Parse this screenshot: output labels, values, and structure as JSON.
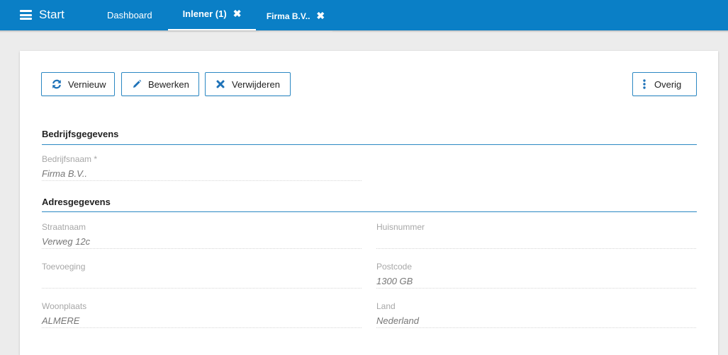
{
  "topbar": {
    "menu_label": "Start",
    "tabs": [
      {
        "label": "Dashboard"
      },
      {
        "label": "Inlener (1)",
        "close": "✖"
      },
      {
        "label": "Firma B.V..",
        "close": "✖"
      }
    ],
    "bar_color": "#0a7fc6"
  },
  "toolbar": {
    "refresh_label": "Vernieuw",
    "edit_label": "Bewerken",
    "delete_label": "Verwijderen",
    "more_label": "Overig",
    "accent": "#2b88c3"
  },
  "sections": {
    "company": {
      "title": "Bedrijfsgegevens",
      "fields": {
        "name": {
          "label": "Bedrijfsnaam *",
          "value": "Firma B.V.."
        }
      }
    },
    "address": {
      "title": "Adresgegevens",
      "fields": {
        "street": {
          "label": "Straatnaam",
          "value": "Verweg 12c"
        },
        "number": {
          "label": "Huisnummer",
          "value": ""
        },
        "addition": {
          "label": "Toevoeging",
          "value": ""
        },
        "postcode": {
          "label": "Postcode",
          "value": "1300 GB"
        },
        "city": {
          "label": "Woonplaats",
          "value": "ALMERE"
        },
        "country": {
          "label": "Land",
          "value": "Nederland"
        }
      }
    }
  }
}
